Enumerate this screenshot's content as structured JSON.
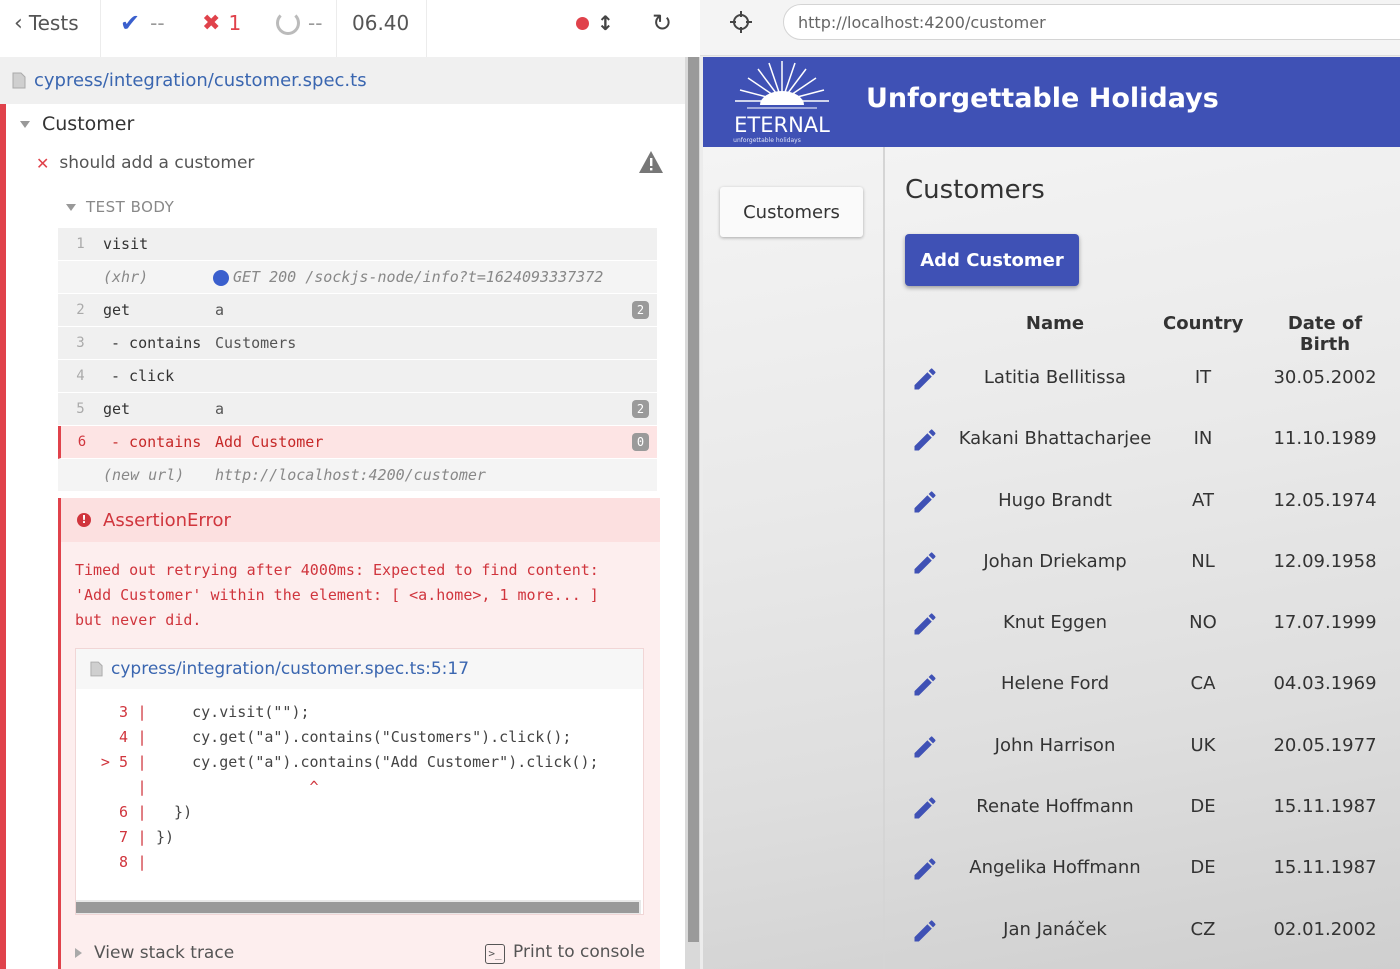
{
  "stats": {
    "back_label": "Tests",
    "passed": "--",
    "failed": "1",
    "pending": "--",
    "duration": "06.40"
  },
  "spec": {
    "path": "cypress/integration/customer.spec.ts"
  },
  "suite": {
    "title": "Customer"
  },
  "test": {
    "title": "should add a customer",
    "body_label": "TEST BODY"
  },
  "commands": [
    {
      "num": "1",
      "name": "visit",
      "msg": "",
      "badge": ""
    },
    {
      "num": "",
      "name": "(xhr)",
      "msg": "GET 200 /sockjs-node/info?t=1624093337372",
      "badge": ""
    },
    {
      "num": "2",
      "name": "get",
      "msg": "a",
      "badge": "2"
    },
    {
      "num": "3",
      "name": "- contains",
      "msg": "Customers",
      "badge": ""
    },
    {
      "num": "4",
      "name": "- click",
      "msg": "",
      "badge": ""
    },
    {
      "num": "5",
      "name": "get",
      "msg": "a",
      "badge": "2"
    },
    {
      "num": "6",
      "name": "- contains",
      "msg": "Add Customer",
      "badge": "0"
    },
    {
      "num": "",
      "name": "(new url)",
      "msg": "http://localhost:4200/customer",
      "badge": ""
    }
  ],
  "error": {
    "title": "AssertionError",
    "message": "Timed out retrying after 4000ms: Expected to find content:\n'Add Customer' within the element: [ <a.home>, 1 more... ]\nbut never did.",
    "file": "cypress/integration/customer.spec.ts:5:17",
    "code_lines": [
      {
        "ln": "3",
        "marker": "",
        "src": "    cy.visit(\"\");"
      },
      {
        "ln": "4",
        "marker": "",
        "src": "    cy.get(\"a\").contains(\"Customers\").click();"
      },
      {
        "ln": "5",
        "marker": ">",
        "src": "    cy.get(\"a\").contains(\"Add Customer\").click();"
      },
      {
        "ln": "",
        "marker": "",
        "src": "                 ^"
      },
      {
        "ln": "6",
        "marker": "",
        "src": "  })"
      },
      {
        "ln": "7",
        "marker": "",
        "src": "})"
      },
      {
        "ln": "8",
        "marker": "",
        "src": ""
      }
    ],
    "stack_label": "View stack trace",
    "print_label": "Print to console"
  },
  "browser": {
    "url": "http://localhost:4200/customer"
  },
  "app": {
    "title": "Unforgettable Holidays",
    "logo_text": "ETERNAL",
    "logo_sub": "unforgettable holidays",
    "nav_customers": "Customers",
    "page_title": "Customers",
    "add_button": "Add Customer",
    "table_headers": {
      "name": "Name",
      "country": "Country",
      "dob": "Date of Birth"
    },
    "customers": [
      {
        "name": "Latitia Bellitissa",
        "country": "IT",
        "dob": "30.05.2002"
      },
      {
        "name": "Kakani Bhattacharjee",
        "country": "IN",
        "dob": "11.10.1989"
      },
      {
        "name": "Hugo Brandt",
        "country": "AT",
        "dob": "12.05.1974"
      },
      {
        "name": "Johan Driekamp",
        "country": "NL",
        "dob": "12.09.1958"
      },
      {
        "name": "Knut Eggen",
        "country": "NO",
        "dob": "17.07.1999"
      },
      {
        "name": "Helene Ford",
        "country": "CA",
        "dob": "04.03.1969"
      },
      {
        "name": "John Harrison",
        "country": "UK",
        "dob": "20.05.1977"
      },
      {
        "name": "Renate Hoffmann",
        "country": "DE",
        "dob": "15.11.1987"
      },
      {
        "name": "Angelika Hoffmann",
        "country": "DE",
        "dob": "15.11.1987"
      },
      {
        "name": "Jan Janáček",
        "country": "CZ",
        "dob": "02.01.2002"
      }
    ]
  },
  "colors": {
    "brand": "#3f51b5",
    "fail": "#e0424b",
    "link": "#3a66b0"
  }
}
